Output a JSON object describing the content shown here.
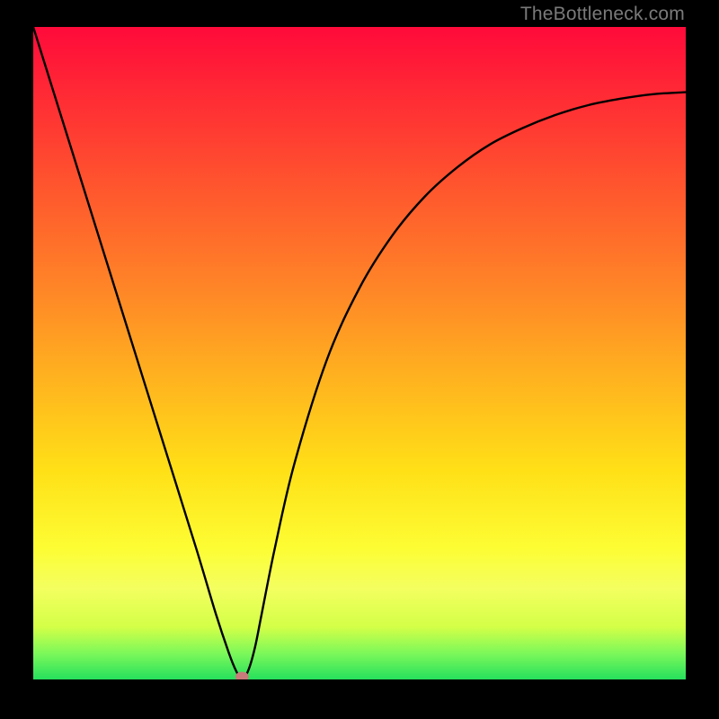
{
  "watermark": "TheBottleneck.com",
  "chart_data": {
    "type": "line",
    "title": "",
    "xlabel": "",
    "ylabel": "",
    "xlim": [
      0,
      100
    ],
    "ylim": [
      0,
      100
    ],
    "series": [
      {
        "name": "curve",
        "x": [
          0,
          5,
          10,
          15,
          20,
          25,
          28,
          30,
          31,
          32,
          33,
          34,
          35,
          37,
          40,
          45,
          50,
          55,
          60,
          65,
          70,
          75,
          80,
          85,
          90,
          95,
          100
        ],
        "y": [
          100,
          84,
          68,
          52,
          36,
          20,
          10,
          4,
          1.5,
          0,
          1.5,
          5,
          10,
          20,
          33,
          49,
          60,
          68,
          74,
          78.5,
          82,
          84.5,
          86.5,
          88,
          89,
          89.7,
          90
        ]
      }
    ],
    "marker": {
      "x": 32,
      "y": 0
    },
    "background_gradient": [
      "#ff0a3a",
      "#ffe017",
      "#26e05d"
    ]
  }
}
